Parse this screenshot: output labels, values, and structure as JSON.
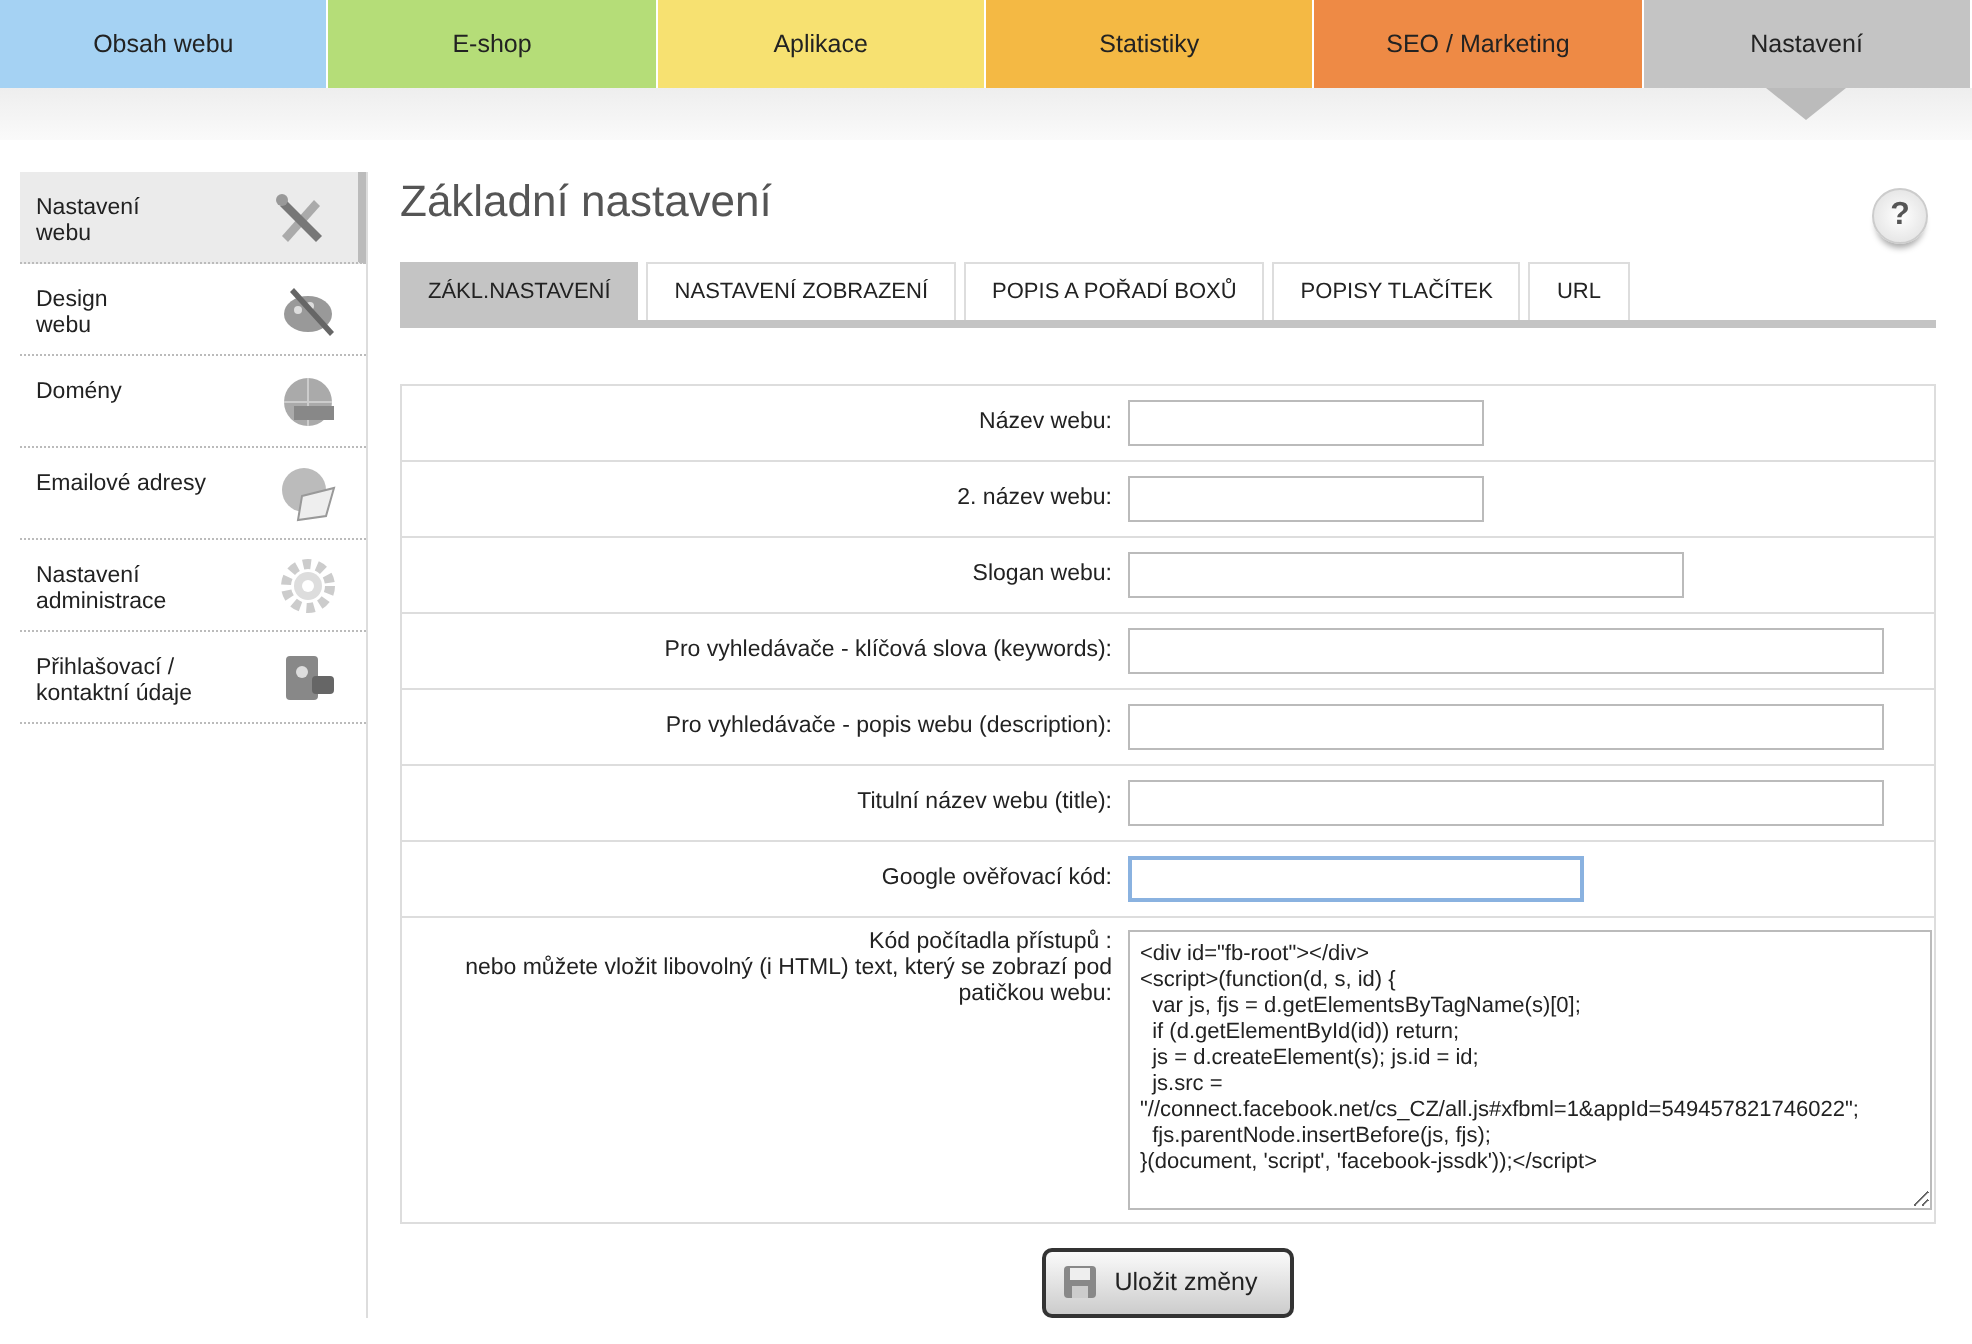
{
  "top_nav": [
    {
      "label": "Obsah webu",
      "color": "#a5d2f3",
      "selected": false
    },
    {
      "label": "E-shop",
      "color": "#b5dd78",
      "selected": false
    },
    {
      "label": "Aplikace",
      "color": "#f7e171",
      "selected": false
    },
    {
      "label": "Statistiky",
      "color": "#f4b944",
      "selected": false
    },
    {
      "label": "SEO / Marketing",
      "color": "#ee8a45",
      "selected": false
    },
    {
      "label": "Nastavení",
      "color": "#c4c4c4",
      "selected": true
    }
  ],
  "sidebar": {
    "items": [
      {
        "label": "Nastavení\nwebu",
        "selected": true
      },
      {
        "label": "Design\nwebu",
        "selected": false
      },
      {
        "label": "Domény",
        "selected": false
      },
      {
        "label": "Emailové adresy",
        "selected": false
      },
      {
        "label": "Nastavení\nadministrace",
        "selected": false
      },
      {
        "label": "Přihlašovací /\nkontaktní údaje",
        "selected": false
      }
    ]
  },
  "page_title": "Základní nastavení",
  "help_button": "?",
  "tabs": [
    {
      "label": "ZÁKL.NASTAVENÍ",
      "selected": true
    },
    {
      "label": "NASTAVENÍ ZOBRAZENÍ",
      "selected": false
    },
    {
      "label": "POPIS A POŘADÍ BOXŮ",
      "selected": false
    },
    {
      "label": "POPISY TLAČÍTEK",
      "selected": false
    },
    {
      "label": "URL",
      "selected": false
    }
  ],
  "fields": [
    {
      "label": "Název webu:",
      "kind": "input",
      "focused": false
    },
    {
      "label": "2. název webu:",
      "kind": "input",
      "focused": false
    },
    {
      "label": "Slogan webu:",
      "kind": "input",
      "focused": false
    },
    {
      "label": "Pro vyhledávače - klíčová slova (keywords):",
      "kind": "input",
      "focused": false
    },
    {
      "label": "Pro vyhledávače - popis webu (description):",
      "kind": "input",
      "focused": false
    },
    {
      "label": "Titulní název webu (title):",
      "kind": "input",
      "focused": false
    },
    {
      "label": "Google ověřovací kód:",
      "kind": "input",
      "focused": true
    },
    {
      "label": "Kód počítadla přístupů :\nnebo můžete vložit libovolný (i HTML) text, který se zobrazí pod\npatičkou webu:",
      "kind": "textarea",
      "value": "<div id=\"fb-root\"></div>\n<script>(function(d, s, id) {\n  var js, fjs = d.getElementsByTagName(s)[0];\n  if (d.getElementById(id)) return;\n  js = d.createElement(s); js.id = id;\n  js.src = \n\"//connect.facebook.net/cs_CZ/all.js#xfbml=1&appId=549457821746022\";\n  fjs.parentNode.insertBefore(js, fjs);\n}(document, 'script', 'facebook-jssdk'));</script>"
    }
  ],
  "save_button": "Uložit změny"
}
